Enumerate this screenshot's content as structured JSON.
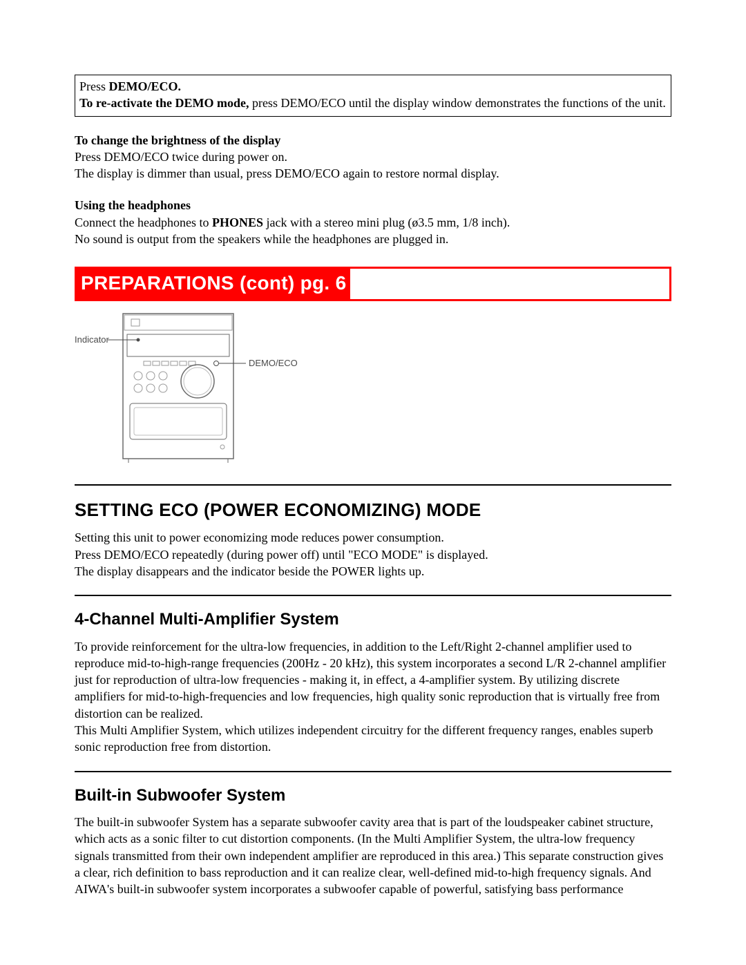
{
  "box1": {
    "line1a": "Press ",
    "line1b": "DEMO/ECO.",
    "line2a": "To re-activate the DEMO mode, ",
    "line2b": "press DEMO/ECO until the display window demonstrates the functions of the unit."
  },
  "brightness": {
    "header": "To change the brightness of the display",
    "line1": "Press DEMO/ECO twice during power on.",
    "line2": "The display is dimmer than usual, press DEMO/ECO again to restore normal display."
  },
  "headphones": {
    "header": "Using the headphones",
    "line1a": "Connect the headphones to ",
    "line1b": "PHONES",
    "line1c": " jack with a stereo mini plug (ø3.5 mm, 1/8 inch).",
    "line2": "No sound is output from the speakers while the headphones are plugged in."
  },
  "banner": "PREPARATIONS (cont)   pg. 6",
  "diagram": {
    "label_left": "Indicator",
    "label_right": "DEMO/ECO"
  },
  "eco": {
    "heading": "SETTING ECO (POWER ECONOMIZING) MODE",
    "l1": "Setting this unit to power economizing mode reduces power consumption.",
    "l2": "Press DEMO/ECO repeatedly (during power off) until \"ECO MODE\" is displayed.",
    "l3": "The display disappears and the indicator beside the POWER lights up."
  },
  "ch4": {
    "heading": "4-Channel Multi-Amplifier System",
    "p": "To provide reinforcement for the ultra-low frequencies, in addition to the Left/Right 2-channel amplifier used to reproduce mid-to-high-range frequencies (200Hz - 20 kHz), this system incorporates a second L/R 2-channel amplifier just for reproduction of ultra-low frequencies - making it, in effect, a 4-amplifier system. By utilizing discrete amplifiers for mid-to-high-frequencies and low frequencies, high quality sonic reproduction that is virtually free from distortion can be realized.",
    "p2": "This Multi Amplifier System, which utilizes independent circuitry for the different frequency ranges, enables superb sonic reproduction free from distortion."
  },
  "sub": {
    "heading": "Built-in Subwoofer System",
    "p": "The built-in subwoofer System has a separate subwoofer cavity area that is part of the loudspeaker cabinet structure, which acts as a sonic filter to cut distortion components. (In the Multi Amplifier System, the ultra-low frequency signals transmitted from their own independent amplifier are reproduced in this area.) This separate construction gives a clear, rich definition to bass reproduction and it can realize clear, well-defined mid-to-high frequency signals. And AIWA's built-in subwoofer system incorporates a subwoofer capable of powerful, satisfying bass performance"
  }
}
